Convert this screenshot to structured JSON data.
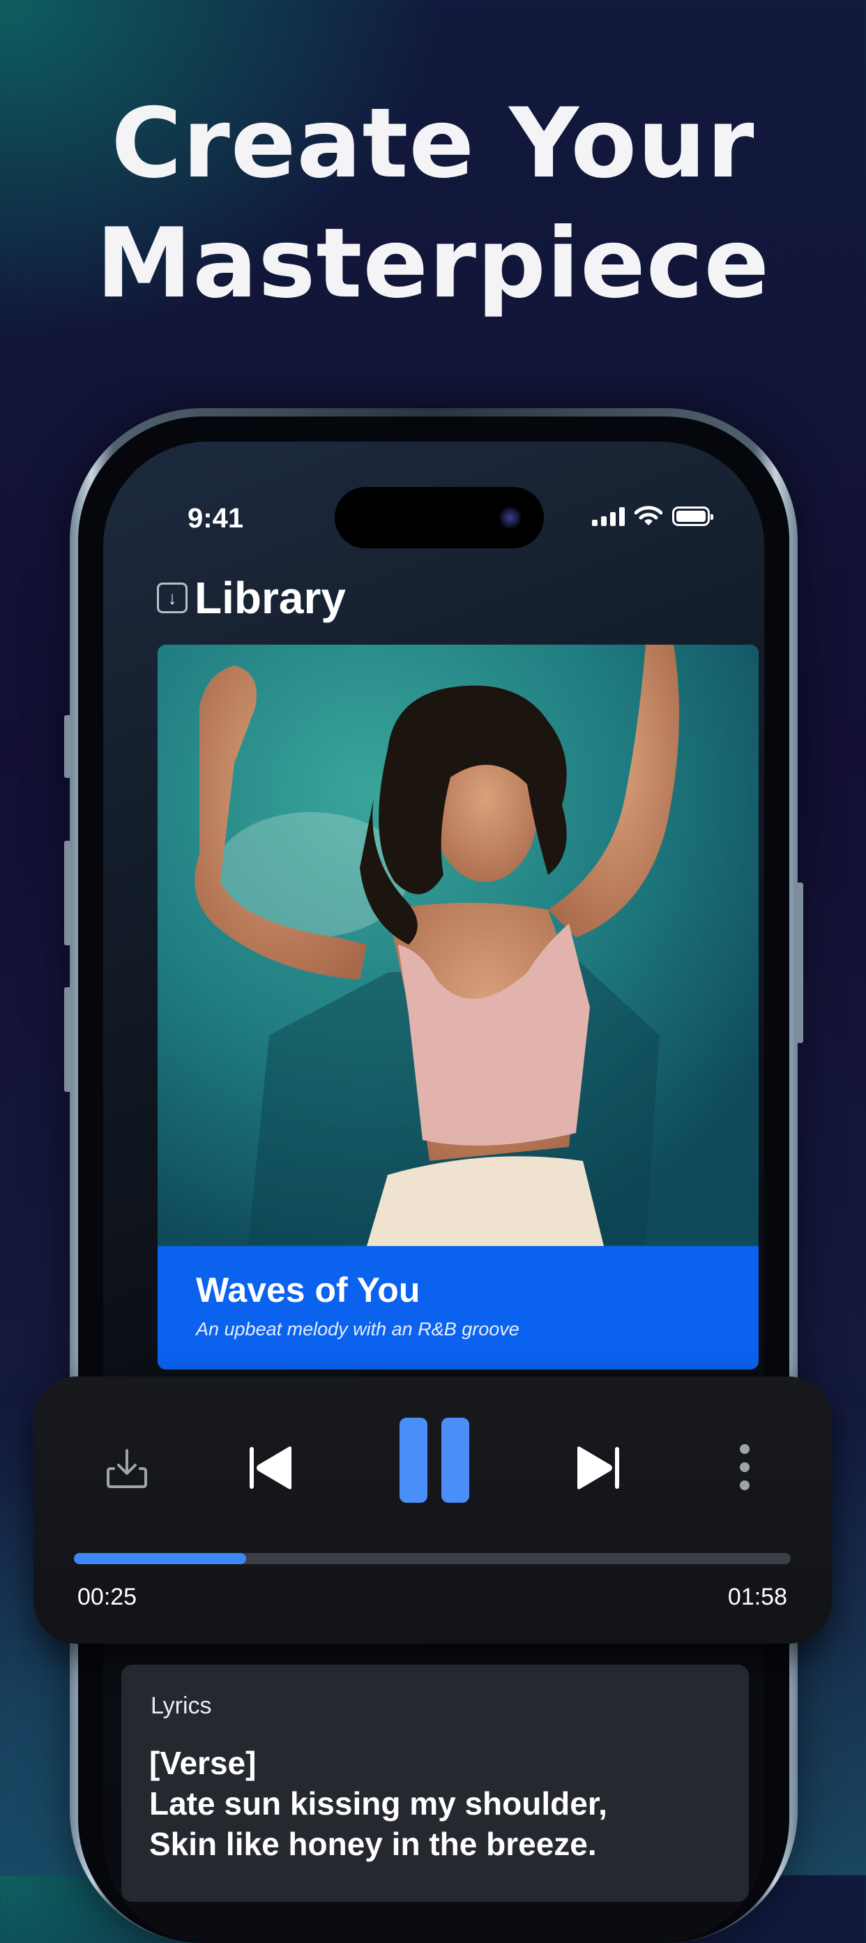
{
  "headline": {
    "line1": "Create Your",
    "line2": "Masterpiece"
  },
  "status_bar": {
    "time": "9:41",
    "icons": [
      "cellular-signal-icon",
      "wifi-icon",
      "battery-icon"
    ]
  },
  "library": {
    "title": "Library",
    "icon": "download-icon"
  },
  "track": {
    "title": "Waves of You",
    "description": "An upbeat melody with an R&B groove"
  },
  "player": {
    "controls": [
      "download-icon",
      "previous-icon",
      "pause-icon",
      "next-icon",
      "more-options-icon"
    ],
    "current_time": "00:25",
    "total_time": "01:58",
    "progress": 0.24,
    "accent_color": "#3e87f7"
  },
  "lyrics": {
    "label": "Lyrics",
    "lines": [
      "[Verse]",
      "Late sun kissing my shoulder,",
      "Skin like honey in the breeze."
    ]
  }
}
